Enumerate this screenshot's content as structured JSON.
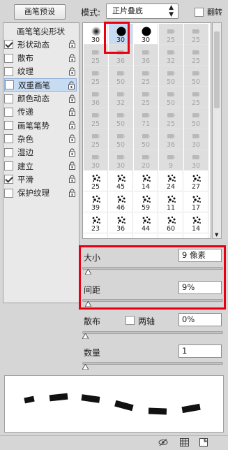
{
  "header": {
    "presets_button": "画笔预设",
    "mode_label": "模式:",
    "mode_value": "正片叠底",
    "flip_label": "翻转"
  },
  "options": [
    {
      "label": "画笔笔尖形状",
      "checkbox": false,
      "checked": false,
      "lock": false
    },
    {
      "label": "形状动态",
      "checkbox": true,
      "checked": true,
      "lock": true
    },
    {
      "label": "散布",
      "checkbox": true,
      "checked": false,
      "lock": true
    },
    {
      "label": "纹理",
      "checkbox": true,
      "checked": false,
      "lock": true
    },
    {
      "label": "双重画笔",
      "checkbox": true,
      "checked": false,
      "lock": true,
      "active": true
    },
    {
      "label": "颜色动态",
      "checkbox": true,
      "checked": false,
      "lock": true
    },
    {
      "label": "传递",
      "checkbox": true,
      "checked": false,
      "lock": true
    },
    {
      "label": "画笔笔势",
      "checkbox": true,
      "checked": false,
      "lock": true
    },
    {
      "label": "杂色",
      "checkbox": true,
      "checked": false,
      "lock": true
    },
    {
      "label": "湿边",
      "checkbox": true,
      "checked": false,
      "lock": true
    },
    {
      "label": "建立",
      "checkbox": true,
      "checked": false,
      "lock": true
    },
    {
      "label": "平滑",
      "checkbox": true,
      "checked": true,
      "lock": true
    },
    {
      "label": "保护纹理",
      "checkbox": true,
      "checked": false,
      "lock": true
    }
  ],
  "brushes": [
    [
      {
        "n": "30",
        "k": "soft"
      },
      {
        "n": "30",
        "k": "hard",
        "sel": true
      },
      {
        "n": "30",
        "k": "hard"
      },
      {
        "n": "25",
        "k": "g"
      },
      {
        "n": "25",
        "k": "g"
      }
    ],
    [
      {
        "n": "25",
        "k": "g"
      },
      {
        "n": "36",
        "k": "g"
      },
      {
        "n": "36",
        "k": "g"
      },
      {
        "n": "32",
        "k": "g"
      },
      {
        "n": "25",
        "k": "g"
      }
    ],
    [
      {
        "n": "25",
        "k": "g"
      },
      {
        "n": "50",
        "k": "g"
      },
      {
        "n": "25",
        "k": "g"
      },
      {
        "n": "50",
        "k": "g"
      },
      {
        "n": "50",
        "k": "g"
      }
    ],
    [
      {
        "n": "36",
        "k": "g"
      },
      {
        "n": "32",
        "k": "g"
      },
      {
        "n": "25",
        "k": "g"
      },
      {
        "n": "50",
        "k": "g"
      },
      {
        "n": "25",
        "k": "g"
      }
    ],
    [
      {
        "n": "25",
        "k": "g"
      },
      {
        "n": "50",
        "k": "g"
      },
      {
        "n": "71",
        "k": "g"
      },
      {
        "n": "25",
        "k": "g"
      },
      {
        "n": "50",
        "k": "g"
      }
    ],
    [
      {
        "n": "25",
        "k": "g"
      },
      {
        "n": "50",
        "k": "g"
      },
      {
        "n": "50",
        "k": "g"
      },
      {
        "n": "36",
        "k": "g"
      },
      {
        "n": "30",
        "k": "g"
      }
    ],
    [
      {
        "n": "30",
        "k": "g"
      },
      {
        "n": "30",
        "k": "g"
      },
      {
        "n": "20",
        "k": "g"
      },
      {
        "n": "9",
        "k": "g"
      },
      {
        "n": "30",
        "k": "g"
      }
    ],
    [
      {
        "n": "25",
        "k": "s"
      },
      {
        "n": "45",
        "k": "s"
      },
      {
        "n": "14",
        "k": "s"
      },
      {
        "n": "24",
        "k": "s"
      },
      {
        "n": "27",
        "k": "s"
      }
    ],
    [
      {
        "n": "39",
        "k": "s"
      },
      {
        "n": "46",
        "k": "s"
      },
      {
        "n": "59",
        "k": "s"
      },
      {
        "n": "11",
        "k": "s"
      },
      {
        "n": "17",
        "k": "s"
      }
    ],
    [
      {
        "n": "23",
        "k": "s"
      },
      {
        "n": "36",
        "k": "s"
      },
      {
        "n": "44",
        "k": "s"
      },
      {
        "n": "60",
        "k": "s"
      },
      {
        "n": "14",
        "k": "s"
      }
    ],
    [
      {
        "n": "",
        "k": "d"
      },
      {
        "n": "",
        "k": "d"
      },
      {
        "n": "",
        "k": "d"
      },
      {
        "n": "",
        "k": "d"
      },
      {
        "n": "",
        "k": "d"
      }
    ]
  ],
  "size": {
    "label": "大小",
    "value": "9 像素",
    "level": 0.02
  },
  "spacing": {
    "label": "间距",
    "value": "9%",
    "level": 0.02
  },
  "scatter": {
    "label": "散布",
    "both_axes_label": "两轴",
    "both_axes_checked": false,
    "value": "0%",
    "level": 0.0
  },
  "count": {
    "label": "数量",
    "value": "1",
    "level": 0.0
  },
  "colors": {
    "highlight": "#e60012",
    "active_row": "#c7dbf2"
  }
}
